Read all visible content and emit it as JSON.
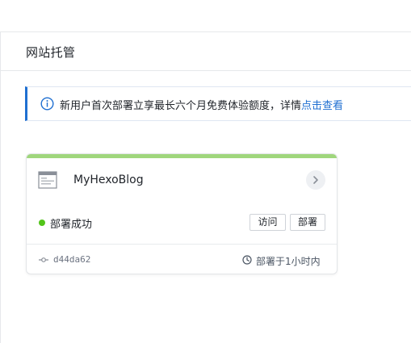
{
  "page": {
    "title": "网站托管"
  },
  "notice": {
    "text": "新用户首次部署立享最长六个月免费体验额度，详情",
    "link": "点击查看",
    "icon": "info-icon",
    "accent": "#1f6fd1"
  },
  "site_card": {
    "name": "MyHexoBlog",
    "status": "部署成功",
    "status_color": "#52c41a",
    "topbar_color": "#9fd67c",
    "visit_label": "访问",
    "deploy_label": "部署",
    "commit": "d44da62",
    "deployed_at": "部署于1小时内",
    "icons": [
      "browser-window-icon",
      "chevron-right-icon",
      "git-commit-icon",
      "clock-icon"
    ]
  }
}
